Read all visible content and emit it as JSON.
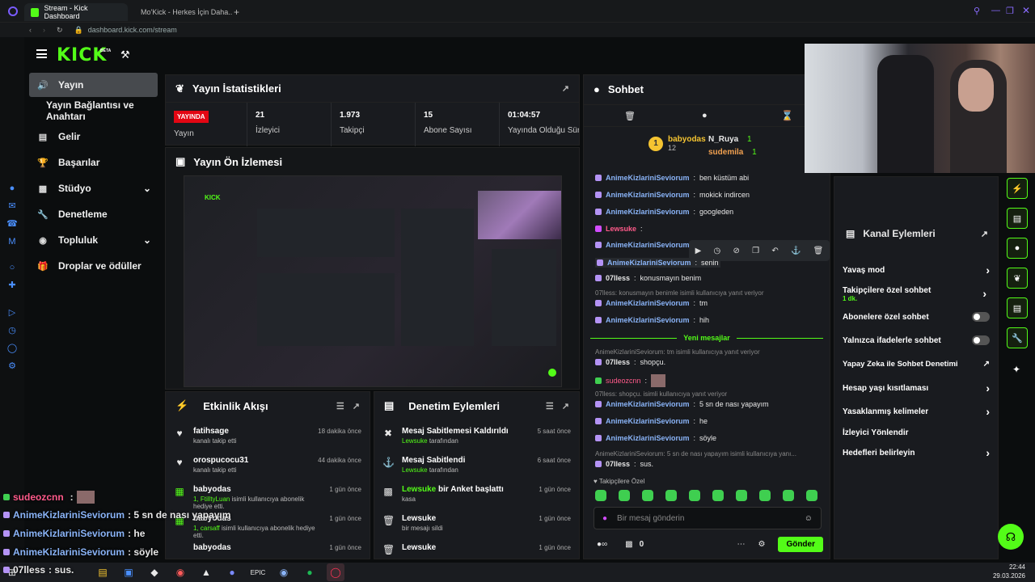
{
  "browser": {
    "tabs": [
      {
        "label": "Stream - Kick Dashboard"
      },
      {
        "label": "Mo'Kick - Herkes İçin Daha..."
      }
    ],
    "url": "dashboard.kick.com/stream"
  },
  "header": {
    "logo": "KICK",
    "beta": "BETA"
  },
  "sidebar": {
    "items": [
      {
        "label": "Yayın"
      },
      {
        "label": "Yayın Bağlantısı ve Anahtarı"
      },
      {
        "label": "Gelir"
      },
      {
        "label": "Başarılar"
      },
      {
        "label": "Stüdyo"
      },
      {
        "label": "Denetleme"
      },
      {
        "label": "Topluluk"
      },
      {
        "label": "Droplar ve ödüller"
      }
    ]
  },
  "stats": {
    "title": "Yayın İstatistikleri",
    "cells": [
      {
        "value": "YAYINDA",
        "label": "Yayın"
      },
      {
        "value": "21",
        "label": "İzleyici"
      },
      {
        "value": "1.973",
        "label": "Takipçi"
      },
      {
        "value": "15",
        "label": "Abone Sayısı"
      },
      {
        "value": "01:04:57",
        "label": "Yayında Olduğu Süre"
      }
    ]
  },
  "preview": {
    "title": "Yayın Ön İzlemesi"
  },
  "activity": {
    "title": "Etkinlik Akışı",
    "items": [
      {
        "name": "fatihsage",
        "sub": "kanalı takip etti",
        "time": "18 dakika önce"
      },
      {
        "name": "orospucocu31",
        "sub": "kanalı takip etti",
        "time": "44 dakika önce"
      },
      {
        "name": "babyodas",
        "sub_user": "1, FtilltyLuan",
        "sub": "isimli kullanıcıya abonelik hediye etti.",
        "time": "1 gün önce"
      },
      {
        "name": "babyodas",
        "sub_user": "1, carsaff",
        "sub": "isimli kullanıcıya abonelik hediye etti.",
        "time": "1 gün önce"
      },
      {
        "name": "babyodas",
        "sub": "",
        "time": "1 gün önce"
      }
    ]
  },
  "moderation": {
    "title": "Denetim Eylemleri",
    "items": [
      {
        "name": "Mesaj Sabitlemesi Kaldırıldı",
        "user": "Lewsuke",
        "sub": "tarafından",
        "time": "5 saat önce"
      },
      {
        "name": "Mesaj Sabitlendi",
        "user": "Lewsuke",
        "sub": "tarafından",
        "time": "6 saat önce"
      },
      {
        "name": "bir Anket başlattı",
        "user": "Lewsuke",
        "sub": "kasa",
        "time": "1 gün önce"
      },
      {
        "name": "Lewsuke",
        "sub": "bir mesajı sildi",
        "time": "1 gün önce"
      },
      {
        "name": "Lewsuke",
        "sub": "",
        "time": "1 gün önce"
      }
    ]
  },
  "chat": {
    "title": "Sohbet",
    "top": [
      {
        "rank": "1",
        "name": "babyodas",
        "count": "12"
      },
      {
        "name": "N_Ruya",
        "count": "1"
      },
      {
        "name": "sudemila",
        "count": "1"
      }
    ],
    "messages": [
      {
        "user": "AnimeKizlariniSeviorum",
        "text": "ben küstüm abi"
      },
      {
        "user": "AnimeKizlariniSeviorum",
        "text": "mokick indircen"
      },
      {
        "user": "AnimeKizlariniSeviorum",
        "text": "googleden"
      },
      {
        "user": "Lewsuke",
        "text": ":"
      },
      {
        "user": "AnimeKizlariniSeviorum",
        "text": ""
      },
      {
        "user": "AnimeKizlariniSeviorum",
        "text": "senin"
      },
      {
        "user": "07lless",
        "text": "konusmayın benim"
      },
      {
        "reply": "07lless: konusmayın benimle isimli kullanıcıya yanıt veriyor"
      },
      {
        "user": "AnimeKizlariniSeviorum",
        "text": "tm"
      },
      {
        "user": "AnimeKizlariniSeviorum",
        "text": "hih"
      }
    ],
    "new_messages": "Yeni mesajlar",
    "messages2": [
      {
        "reply": "AnimeKizlariniSeviorum: tm isimli kullanıcıya yanıt veriyor"
      },
      {
        "user": "07lless",
        "text": "shopçu."
      },
      {
        "user": "sudeozcnn",
        "text": ""
      },
      {
        "reply": "07lless: shopçu. isimli kullanıcıya yanıt veriyor"
      },
      {
        "user": "AnimeKizlariniSeviorum",
        "text": "5 sn de nası yapayım"
      },
      {
        "user": "AnimeKizlariniSeviorum",
        "text": "he"
      },
      {
        "user": "AnimeKizlariniSeviorum",
        "text": "söyle"
      },
      {
        "reply": "AnimeKizlariniSeviorum: 5 sn de nası yapayım isimli kullanıcıya yanı..."
      },
      {
        "user": "07lless",
        "text": "sus."
      }
    ],
    "emote_label": "Takipçilere Özel",
    "input_placeholder": "Bir mesaj gönderin",
    "points": "0",
    "send": "Gönder"
  },
  "channel_actions": {
    "title": "Kanal Eylemleri",
    "items": [
      {
        "label": "Yavaş mod",
        "type": "chevron"
      },
      {
        "label": "Takipçilere özel sohbet",
        "sub": "1 dk.",
        "type": "chevron"
      },
      {
        "label": "Abonelere özel sohbet",
        "type": "toggle"
      },
      {
        "label": "Yalnızca ifadelerle sohbet",
        "type": "toggle"
      },
      {
        "label": "Yapay Zeka ile Sohbet Denetimi",
        "type": "link"
      },
      {
        "label": "Hesap yaşı kısıtlaması",
        "type": "chevron"
      },
      {
        "label": "Yasaklanmış kelimeler",
        "type": "chevron"
      },
      {
        "label": "İzleyici Yönlendir",
        "type": "none"
      },
      {
        "label": "Hedefleri belirleyin",
        "type": "chevron"
      }
    ]
  },
  "overlay": [
    {
      "user": "sudeozcnn",
      "text": ""
    },
    {
      "user": "AnimeKizlariniSeviorum",
      "text": ": 5 sn de nası yapayım"
    },
    {
      "user": "AnimeKizlariniSeviorum",
      "text": ": he"
    },
    {
      "user": "AnimeKizlariniSeviorum",
      "text": ": söyle"
    },
    {
      "user": "07lless",
      "text": ": sus."
    }
  ],
  "clock": {
    "time": "22:44",
    "date": "29.03.2026"
  },
  "colors": {
    "brand": "#53fc18",
    "live": "#e30613",
    "panel": "#191b1f"
  }
}
